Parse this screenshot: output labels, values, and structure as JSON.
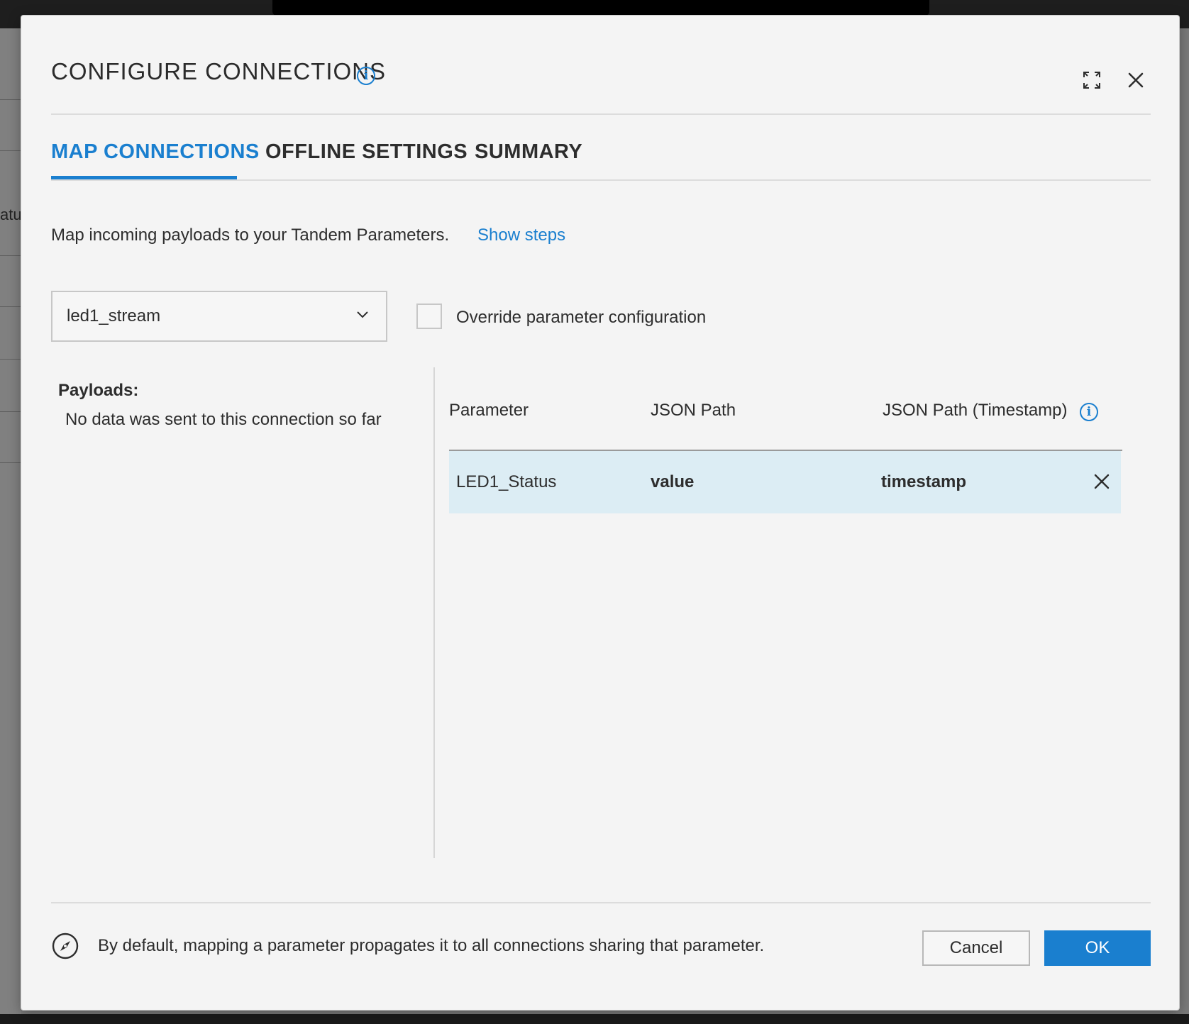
{
  "dialog": {
    "title": "CONFIGURE CONNECTIONS",
    "tabs": [
      {
        "label": "MAP CONNECTIONS",
        "active": true
      },
      {
        "label": "OFFLINE SETTINGS",
        "active": false
      },
      {
        "label": "SUMMARY",
        "active": false
      }
    ],
    "intro_text": "Map incoming payloads to your Tandem Parameters.",
    "show_steps_link": "Show steps",
    "stream_select": {
      "selected": "led1_stream"
    },
    "override_checkbox": {
      "label": "Override parameter configuration",
      "checked": false
    },
    "payloads": {
      "title": "Payloads:",
      "empty_text": "No data was sent to this connection so far"
    },
    "table": {
      "headers": [
        "Parameter",
        "JSON Path",
        "JSON Path (Timestamp)"
      ],
      "rows": [
        {
          "parameter": "LED1_Status",
          "json_path": "value",
          "json_path_timestamp": "timestamp"
        }
      ]
    },
    "footer": {
      "note": "By default, mapping a parameter propagates it to all connections sharing that parameter.",
      "cancel_label": "Cancel",
      "ok_label": "OK"
    }
  },
  "backdrop": {
    "fragment_text": "atu"
  },
  "colors": {
    "accent": "#1a7fcf",
    "row_highlight": "#dcedf4",
    "dialog_bg": "#f4f4f4"
  },
  "icons": [
    "info-icon",
    "expand-icon",
    "close-icon",
    "chevron-down-icon",
    "compass-icon"
  ]
}
